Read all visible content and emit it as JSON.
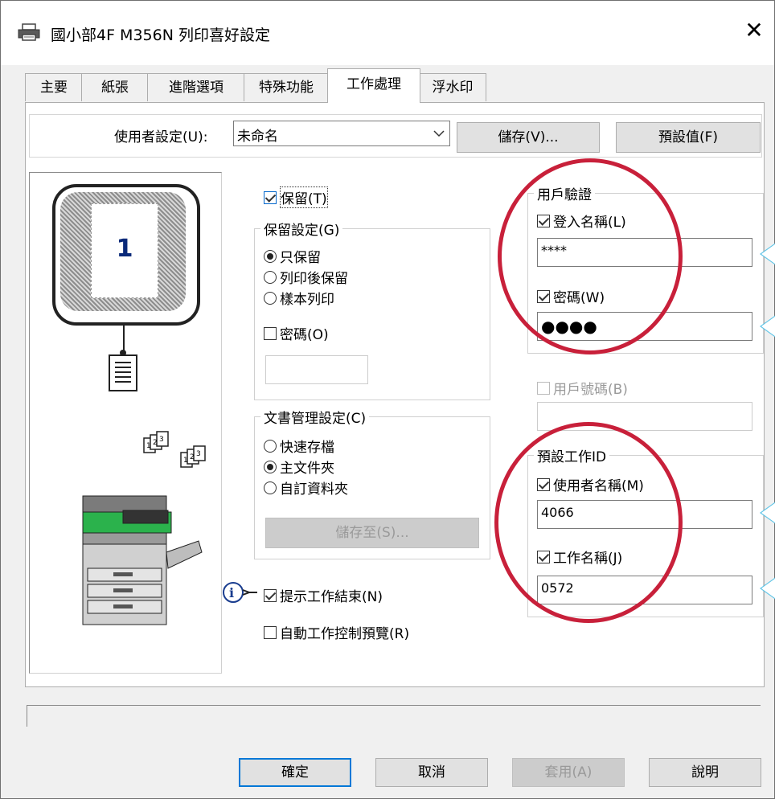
{
  "window": {
    "title": "國小部4F M356N 列印喜好設定",
    "close_icon": "close-icon"
  },
  "tabs": [
    "主要",
    "紙張",
    "進階選項",
    "特殊功能",
    "工作處理",
    "浮水印"
  ],
  "active_tab": "工作處理",
  "user_settings": {
    "label": "使用者設定(U):",
    "value": "未命名",
    "save_button": "儲存(V)...",
    "defaults_button": "預設值(F)"
  },
  "preview": {
    "page_number": "1"
  },
  "retention": {
    "checkbox_label": "保留(T)",
    "checked": true,
    "group_label": "保留設定(G)",
    "options": [
      "只保留",
      "列印後保留",
      "樣本列印"
    ],
    "selected": "只保留",
    "pin_label": "密碼(O)",
    "pin_checked": false,
    "pin_value": ""
  },
  "document_filing": {
    "group_label": "文書管理設定(C)",
    "options": [
      "快速存檔",
      "主文件夾",
      "自訂資料夾"
    ],
    "selected": "主文件夾",
    "store_button": "儲存至(S)..."
  },
  "notify_end": {
    "label": "提示工作結束(N)",
    "checked": true
  },
  "auto_preview": {
    "label": "自動工作控制預覽(R)",
    "checked": false
  },
  "user_auth": {
    "group_label": "用戶驗證",
    "login_label": "登入名稱(L)",
    "login_checked": true,
    "login_value": "****",
    "password_label": "密碼(W)",
    "password_checked": true,
    "password_value": "●●●●"
  },
  "account_number": {
    "label": "用戶號碼(B)",
    "checked": false,
    "value": ""
  },
  "job_id": {
    "group_label": "預設工作ID",
    "user_name_label": "使用者名稱(M)",
    "user_name_checked": true,
    "user_name_value": "4066",
    "job_name_label": "工作名稱(J)",
    "job_name_checked": true,
    "job_name_value": "0572"
  },
  "footer": {
    "ok": "確定",
    "cancel": "取消",
    "apply": "套用(A)",
    "help": "說明"
  },
  "annotation_color": "#c8203a",
  "callout_color": "#5ec5e8"
}
